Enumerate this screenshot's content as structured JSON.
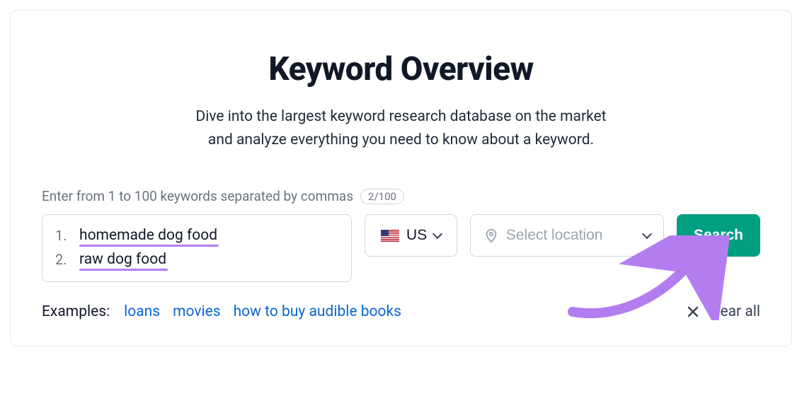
{
  "title": "Keyword Overview",
  "subtitle_line1": "Dive into the largest keyword research database on the market",
  "subtitle_line2": "and analyze everything you need to know about a keyword.",
  "hint": "Enter from 1 to 100 keywords separated by commas",
  "count": "2/100",
  "keywords": [
    {
      "n": "1.",
      "text": "homemade dog food"
    },
    {
      "n": "2.",
      "text": "raw dog food"
    }
  ],
  "country": {
    "code": "US"
  },
  "location": {
    "placeholder": "Select location"
  },
  "search_label": "Search",
  "examples": {
    "label": "Examples:",
    "items": [
      "loans",
      "movies",
      "how to buy audible books"
    ]
  },
  "clear_all": "Clear all",
  "annotation_color": "#b37df0"
}
